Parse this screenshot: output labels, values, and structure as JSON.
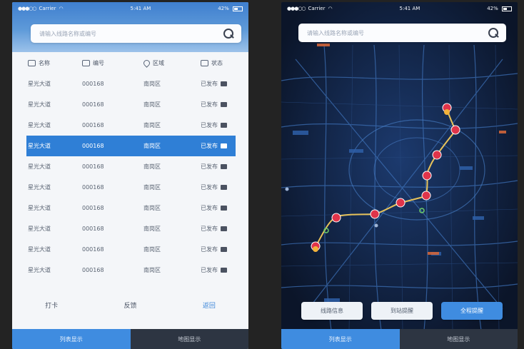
{
  "status": {
    "carrier": "Carrier",
    "time": "5:41 AM",
    "battery": "42%"
  },
  "left": {
    "search_placeholder": "请输入线路名称或编号",
    "columns": [
      "名称",
      "编号",
      "区域",
      "状态"
    ],
    "rows": [
      {
        "name": "星光大道",
        "code": "000168",
        "area": "南岗区",
        "status": "已发布"
      },
      {
        "name": "星光大道",
        "code": "000168",
        "area": "南岗区",
        "status": "已发布"
      },
      {
        "name": "星光大道",
        "code": "000168",
        "area": "南岗区",
        "status": "已发布"
      },
      {
        "name": "星光大道",
        "code": "000168",
        "area": "南岗区",
        "status": "已发布"
      },
      {
        "name": "星光大道",
        "code": "000168",
        "area": "南岗区",
        "status": "已发布"
      },
      {
        "name": "星光大道",
        "code": "000168",
        "area": "南岗区",
        "status": "已发布"
      },
      {
        "name": "星光大道",
        "code": "000168",
        "area": "南岗区",
        "status": "已发布"
      },
      {
        "name": "星光大道",
        "code": "000168",
        "area": "南岗区",
        "status": "已发布"
      },
      {
        "name": "星光大道",
        "code": "000168",
        "area": "南岗区",
        "status": "已发布"
      },
      {
        "name": "星光大道",
        "code": "000168",
        "area": "南岗区",
        "status": "已发布"
      }
    ],
    "selected_row": 3,
    "actions": [
      "打卡",
      "反馈",
      "返回"
    ],
    "tabs": [
      "列表显示",
      "地图显示"
    ]
  },
  "right": {
    "search_placeholder": "请输入线路名称或编号",
    "buttons": [
      "线路信息",
      "到站提醒",
      "全程提醒"
    ],
    "tabs": [
      "列表显示",
      "地图显示"
    ]
  },
  "colors": {
    "accent": "#3f8ce0",
    "map_bg": "#0e1a33",
    "route": "#e8c35a",
    "pin": "#e0344a"
  }
}
